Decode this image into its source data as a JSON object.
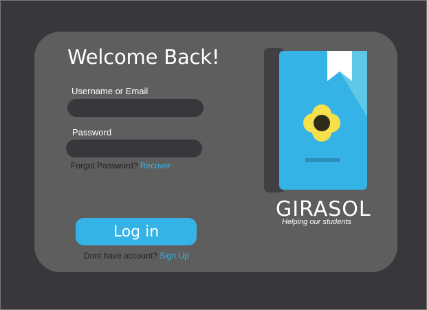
{
  "login": {
    "title": "Welcome Back!",
    "username_label": "Username or Email",
    "username_value": "",
    "password_label": "Password",
    "password_value": "",
    "forgot_text": "Forgot Password?",
    "recover_link": "Recover",
    "login_button": "Log in",
    "no_account_text": "Dont have account?",
    "signup_link": "Sign Up"
  },
  "brand": {
    "name": "GIRASOL",
    "tagline": "Helping our students",
    "logo_icon": "book-with-flower-icon"
  },
  "colors": {
    "background": "#38373b",
    "card": "#5e5e5e",
    "accent": "#36b3e6",
    "flower": "#f6e04c"
  }
}
